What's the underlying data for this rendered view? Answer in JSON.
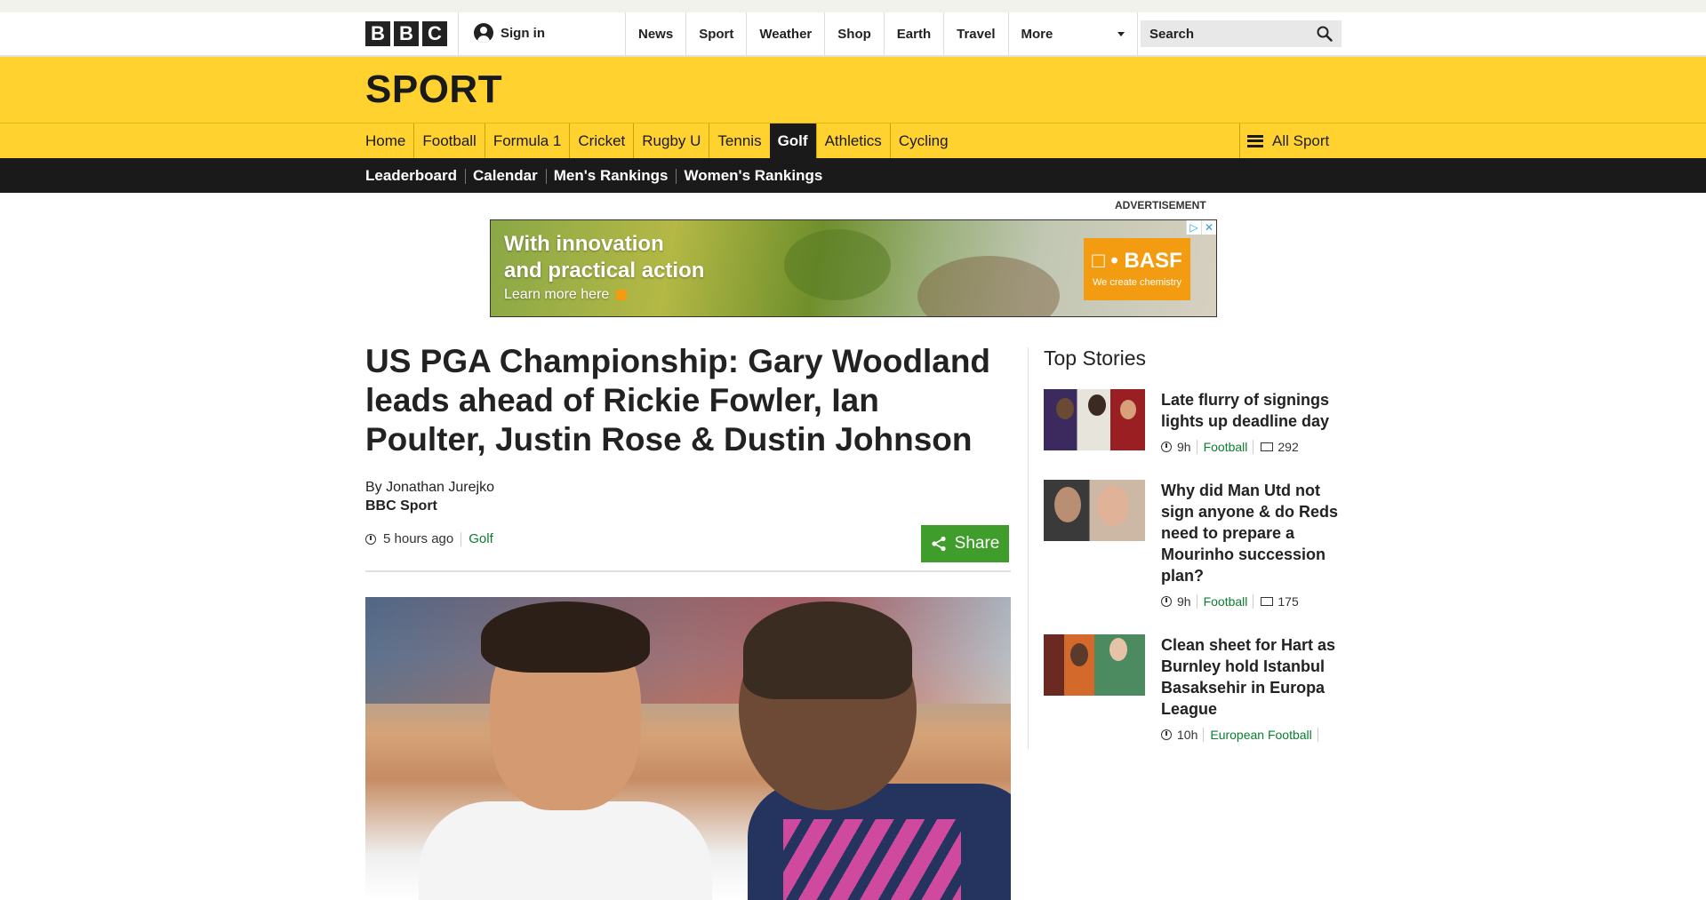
{
  "masthead": {
    "logo_letters": [
      "B",
      "B",
      "C"
    ],
    "signin_label": "Sign in",
    "nav": [
      "News",
      "Sport",
      "Weather",
      "Shop",
      "Earth",
      "Travel"
    ],
    "more_label": "More",
    "search_label": "Search"
  },
  "sport": {
    "title": "SPORT",
    "nav": [
      "Home",
      "Football",
      "Formula 1",
      "Cricket",
      "Rugby U",
      "Tennis",
      "Golf",
      "Athletics",
      "Cycling"
    ],
    "active": "Golf",
    "all_sport_label": "All Sport"
  },
  "golf_subnav": [
    "Leaderboard",
    "Calendar",
    "Men's Rankings",
    "Women's Rankings"
  ],
  "ad": {
    "label": "ADVERTISEMENT",
    "headline_line1": "With innovation",
    "headline_line2": "and practical action",
    "cta": "Learn more here",
    "brand": "□ • BASF",
    "brand_tag": "We create chemistry"
  },
  "article": {
    "headline": "US PGA Championship: Gary Woodland leads ahead of Rickie Fowler, Ian Poulter, Justin Rose & Dustin Johnson",
    "byline": "By Jonathan Jurejko",
    "org": "BBC Sport",
    "time": "5 hours ago",
    "section": "Golf",
    "share_label": "Share"
  },
  "top_stories": {
    "heading": "Top Stories",
    "items": [
      {
        "title": "Late flurry of signings lights up deadline day",
        "time": "9h",
        "section": "Football",
        "comments": "292"
      },
      {
        "title": "Why did Man Utd not sign anyone & do Reds need to prepare a Mourinho succession plan?",
        "time": "9h",
        "section": "Football",
        "comments": "175"
      },
      {
        "title": "Clean sheet for Hart as Burnley hold Istanbul Basaksehir in Europa League",
        "time": "10h",
        "section": "European Football",
        "comments": ""
      }
    ]
  },
  "colors": {
    "sport_yellow": "#ffd230",
    "nav_dark": "#1a1a1a",
    "share_green": "#3f9d2c",
    "link_green": "#0b7d2f"
  }
}
